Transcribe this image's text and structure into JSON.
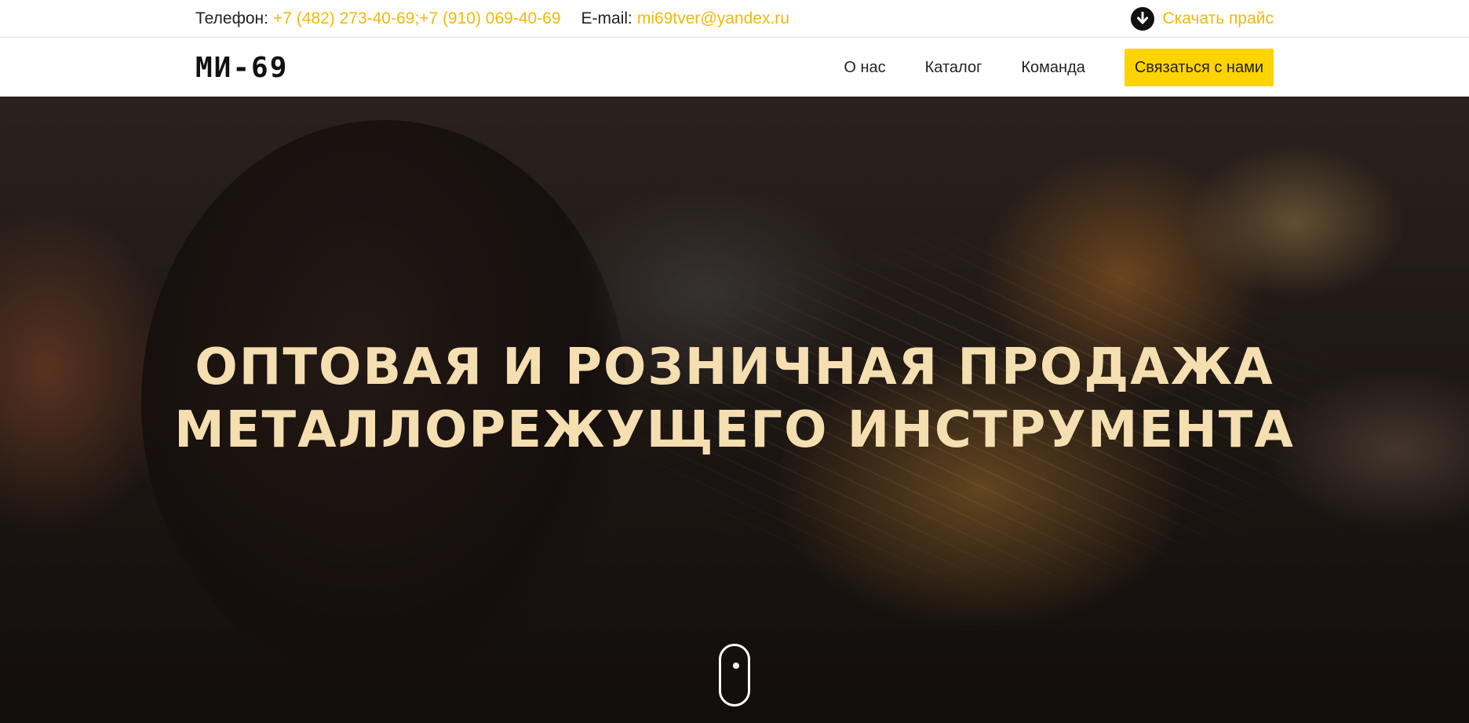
{
  "topbar": {
    "phone_label": "Телефон:",
    "phone_value": "+7 (482) 273-40-69;+7 (910) 069-40-69",
    "email_label": "E-mail:",
    "email_value": "mi69tver@yandex.ru",
    "price_link_label": "Скачать прайс",
    "price_icon": "download-arrow-icon"
  },
  "navbar": {
    "logo": "МИ-69",
    "menu": [
      {
        "label": "О нас"
      },
      {
        "label": "Каталог"
      },
      {
        "label": "Команда"
      }
    ],
    "cta_label": "Связаться с нами"
  },
  "hero": {
    "title_line1": "Оптовая и розничная продажа",
    "title_line2": "металлорежущего инструмента",
    "scroll_icon": "mouse-scroll-icon"
  },
  "colors": {
    "accent": "#f2b90b",
    "cta_background": "#fdd402",
    "hero_text": "#f5deb0"
  }
}
